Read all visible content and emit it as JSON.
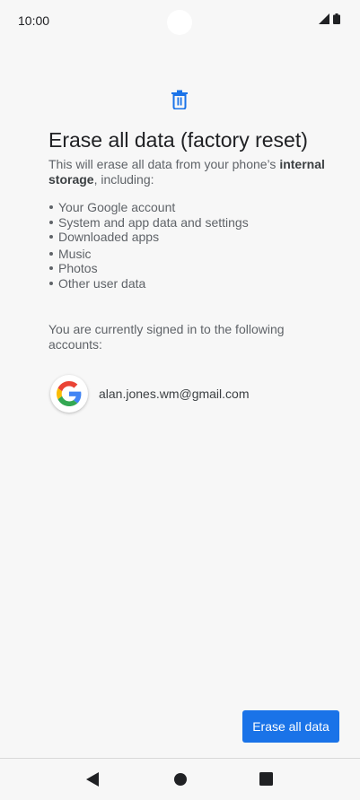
{
  "status_bar": {
    "time": "10:00",
    "icons": [
      "signal-icon",
      "battery-icon"
    ]
  },
  "screen": {
    "header_icon": "trash-icon",
    "title": "Erase all data (factory reset)",
    "intro_before": "This will erase all data from your phone’s ",
    "intro_bold": "internal storage",
    "intro_after": ", including:",
    "items": [
      "Your Google account",
      "System and app data and settings",
      "Downloaded apps",
      "Music",
      "Photos",
      "Other user data"
    ],
    "accounts_text": "You are currently signed in to the following accounts:",
    "account": {
      "icon": "google-icon",
      "email": "alan.jones.wm@gmail.com"
    },
    "erase_button_label": "Erase all data"
  },
  "nav_bar": {
    "buttons": [
      "back-icon",
      "home-icon",
      "recents-icon"
    ]
  },
  "colors": {
    "accent": "#1a73e8",
    "background": "#f7f7f7"
  }
}
